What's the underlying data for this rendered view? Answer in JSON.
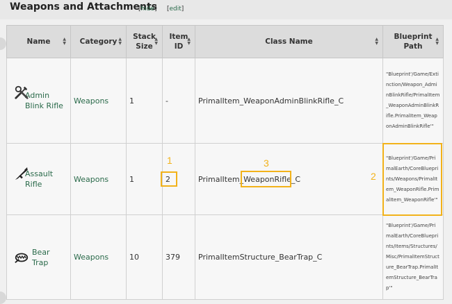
{
  "section": {
    "title": "Weapons and Attachments",
    "hide_link": "hide",
    "edit_link": "edit"
  },
  "table": {
    "headers": {
      "name": "Name",
      "category": "Category",
      "stack_size": "Stack Size",
      "item_id": "Item ID",
      "class_name": "Class Name",
      "blueprint_path": "Blueprint Path"
    },
    "rows": [
      {
        "icon": "wrench-screwdriver-icon",
        "name": "Admin Blink Rifle",
        "category": "Weapons",
        "stack_size": "1",
        "item_id": "-",
        "class_name": "PrimalItem_WeaponAdminBlinkRifle_C",
        "blueprint_path": "\"Blueprint'/Game/Extinction/Weapon_AdminBlinkRifle/PrimalItem_WeaponAdminBlinkRifle.PrimalItem_WeaponAdminBlinkRifle'\""
      },
      {
        "icon": "assault-rifle-icon",
        "name": "Assault Rifle",
        "category": "Weapons",
        "stack_size": "1",
        "item_id": "2",
        "class_name_pre": "PrimalItem_",
        "class_name_mid": "WeaponRifle",
        "class_name_post": "_C",
        "blueprint_path": "\"Blueprint'/Game/PrimalEarth/CoreBlueprints/Weapons/PrimalItem_WeaponRifle.PrimalItem_WeaponRifle'\""
      },
      {
        "icon": "bear-trap-icon",
        "name": "Bear Trap",
        "category": "Weapons",
        "stack_size": "10",
        "item_id": "379",
        "class_name": "PrimalItemStructure_BearTrap_C",
        "blueprint_path": "\"Blueprint'/Game/PrimalEarth/CoreBlueprints/Items/Structures/Misc/PrimalItemStructure_BearTrap.PrimalItemStructure_BearTrap'\""
      }
    ]
  },
  "annotations": {
    "label_1": "1",
    "label_2": "2",
    "label_3": "3",
    "color": "#f2b21a"
  }
}
